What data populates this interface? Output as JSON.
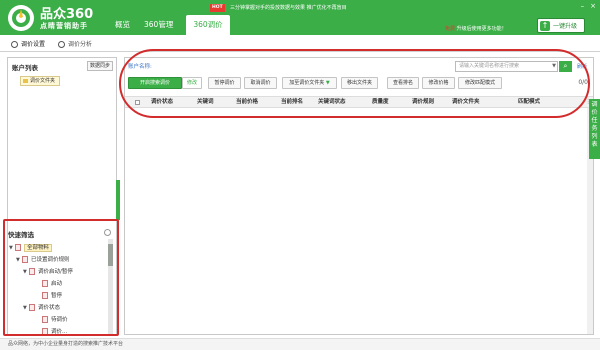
{
  "header": {
    "app_title": "品众360",
    "app_subtitle": "点睛营销助手",
    "nav": [
      "概览",
      "360管理",
      "360调价"
    ],
    "hot_badge": "HOT",
    "notice": "三分钟掌握对手的投放数据与效果  推广优化不再盲目",
    "upgrade_warning": "免费",
    "upgrade_hint": "升级后使用更多功能！",
    "upgrade_button": "一键升级"
  },
  "subtabs": [
    "调价设置",
    "调价分析"
  ],
  "left_panel": {
    "title": "账户列表",
    "sync_button": "数据同步",
    "account": "调价文件夹"
  },
  "quick_filter": {
    "title": "快速筛选",
    "tree": [
      {
        "label": "全部物料"
      },
      {
        "label": "已设置调价规则"
      },
      {
        "label": "调价启动/暂停"
      },
      {
        "label": "启动"
      },
      {
        "label": "暂停"
      },
      {
        "label": "调价状态"
      },
      {
        "label": "待调价"
      },
      {
        "label": "调价..."
      }
    ]
  },
  "main": {
    "account_label": "账户名称:",
    "search_placeholder": "请输入关键词名称进行搜索",
    "refresh": "刷新",
    "toolbar": [
      "开启搜索调价",
      "修改",
      "暂停调价",
      "取消调价",
      "加至调价文件夹",
      "移出文件夹",
      "查看排名",
      "修改价格",
      "修改匹配模式"
    ],
    "count": "0/0",
    "columns": [
      "调价状态",
      "关键词",
      "当前价格",
      "当前排名",
      "关键词状态",
      "质量度",
      "调价规则",
      "调价文件夹",
      "匹配模式"
    ]
  },
  "side_tab": [
    "调",
    "价",
    "任",
    "务",
    "列",
    "表"
  ],
  "footer": "品众网络，为中小企业量身打造的搜索推广技术平台",
  "colors": {
    "brand_green": "#3cae48",
    "annotation_red": "#d32c2c"
  }
}
